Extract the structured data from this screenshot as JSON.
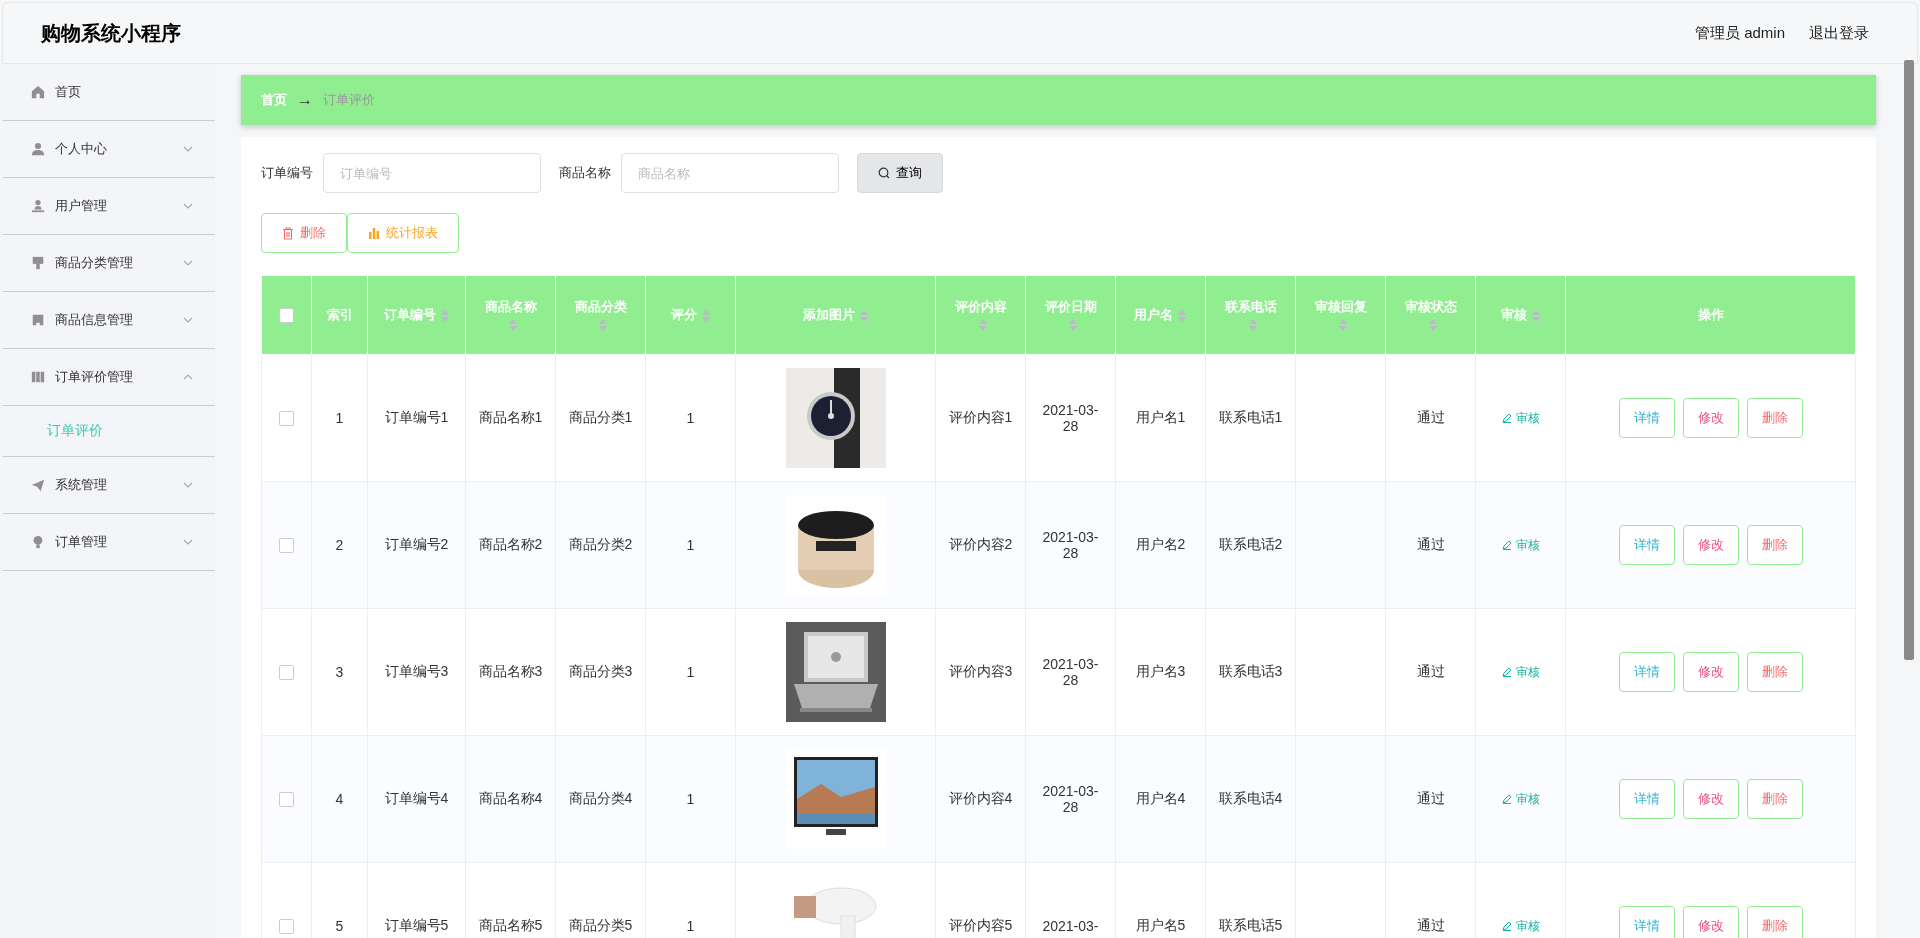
{
  "header": {
    "title": "购物系统小程序",
    "user": "管理员 admin",
    "logout": "退出登录"
  },
  "sidebar": {
    "items": [
      {
        "label": "首页",
        "kind": "link"
      },
      {
        "label": "个人中心",
        "kind": "submenu",
        "expanded": false
      },
      {
        "label": "用户管理",
        "kind": "submenu",
        "expanded": false
      },
      {
        "label": "商品分类管理",
        "kind": "submenu",
        "expanded": false
      },
      {
        "label": "商品信息管理",
        "kind": "submenu",
        "expanded": false
      },
      {
        "label": "订单评价管理",
        "kind": "submenu",
        "expanded": true,
        "children": [
          {
            "label": "订单评价",
            "selected": true
          }
        ]
      },
      {
        "label": "系统管理",
        "kind": "submenu",
        "expanded": false
      },
      {
        "label": "订单管理",
        "kind": "submenu",
        "expanded": false
      }
    ]
  },
  "breadcrumb": [
    "首页",
    "→",
    "订单评价"
  ],
  "search": {
    "fields": [
      {
        "label": "订单编号",
        "placeholder": "订单编号"
      },
      {
        "label": "商品名称",
        "placeholder": "商品名称"
      }
    ],
    "button": "查询"
  },
  "toolbar": [
    {
      "label": "删除",
      "kind": "delete"
    },
    {
      "label": "统计报表",
      "kind": "report"
    }
  ],
  "table": {
    "select_all": {
      "checked": false
    },
    "columns": [
      {
        "label": "索引",
        "sortable": false
      },
      {
        "label": "订单编号",
        "sortable": true
      },
      {
        "label": "商品名称",
        "sortable": true
      },
      {
        "label": "商品分类",
        "sortable": true
      },
      {
        "label": "评分",
        "sortable": true
      },
      {
        "label": "添加图片",
        "sortable": true
      },
      {
        "label": "评价内容",
        "sortable": true
      },
      {
        "label": "评价日期",
        "sortable": true
      },
      {
        "label": "用户名",
        "sortable": true
      },
      {
        "label": "联系电话",
        "sortable": true
      },
      {
        "label": "审核回复",
        "sortable": true
      },
      {
        "label": "审核状态",
        "sortable": true
      },
      {
        "label": "审核",
        "sortable": true
      },
      {
        "label": "操作",
        "sortable": false
      }
    ],
    "rows": [
      {
        "checked": false,
        "index": "1",
        "order_no": "订单编号1",
        "product": "商品名称1",
        "category": "商品分类1",
        "score": "1",
        "review": "评价内容1",
        "date": "2021-03-28",
        "user": "用户名1",
        "phone": "联系电话1",
        "status": "通过",
        "audit": "审核",
        "actions": [
          "详情",
          "修改",
          "删除"
        ]
      },
      {
        "checked": false,
        "index": "2",
        "order_no": "订单编号2",
        "product": "商品名称2",
        "category": "商品分类2",
        "score": "1",
        "review": "评价内容2",
        "date": "2021-03-28",
        "user": "用户名2",
        "phone": "联系电话2",
        "status": "通过",
        "audit": "审核",
        "actions": [
          "详情",
          "修改",
          "删除"
        ]
      },
      {
        "checked": false,
        "index": "3",
        "order_no": "订单编号3",
        "product": "商品名称3",
        "category": "商品分类3",
        "score": "1",
        "review": "评价内容3",
        "date": "2021-03-28",
        "user": "用户名3",
        "phone": "联系电话3",
        "status": "通过",
        "audit": "审核",
        "actions": [
          "详情",
          "修改",
          "删除"
        ]
      },
      {
        "checked": false,
        "index": "4",
        "order_no": "订单编号4",
        "product": "商品名称4",
        "category": "商品分类4",
        "score": "1",
        "review": "评价内容4",
        "date": "2021-03-28",
        "user": "用户名4",
        "phone": "联系电话4",
        "status": "通过",
        "audit": "审核",
        "actions": [
          "详情",
          "修改",
          "删除"
        ]
      },
      {
        "checked": false,
        "index": "5",
        "order_no": "订单编号5",
        "product": "商品名称5",
        "category": "商品分类5",
        "score": "1",
        "review": "评价内容5",
        "date": "2021-03-",
        "user": "用户名5",
        "phone": "联系电话5",
        "status": "通过",
        "audit": "审核",
        "actions": [
          "详情",
          "修改",
          "删除"
        ]
      }
    ]
  }
}
